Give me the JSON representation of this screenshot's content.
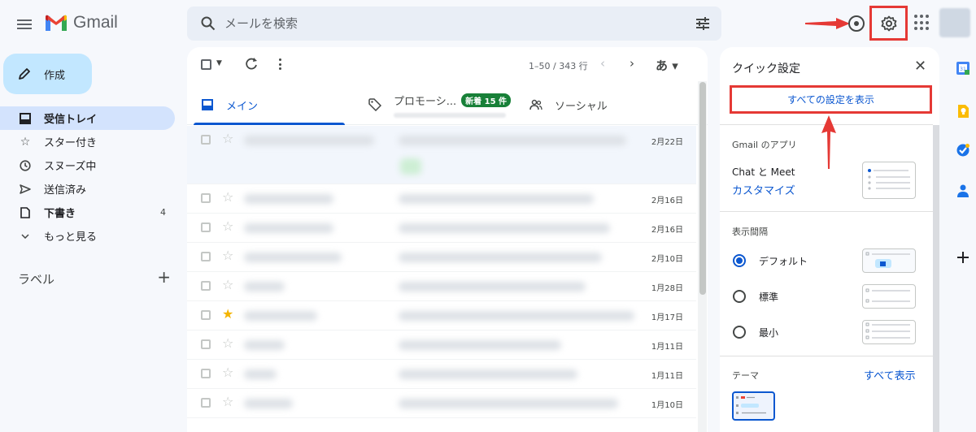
{
  "header": {
    "app_name": "Gmail",
    "search_placeholder": "メールを検索"
  },
  "sidebar": {
    "compose_label": "作成",
    "items": [
      {
        "label": "受信トレイ",
        "icon": "inbox-icon",
        "active": true,
        "count": ""
      },
      {
        "label": "スター付き",
        "icon": "star-icon",
        "count": ""
      },
      {
        "label": "スヌーズ中",
        "icon": "clock-icon",
        "count": ""
      },
      {
        "label": "送信済み",
        "icon": "send-icon",
        "count": ""
      },
      {
        "label": "下書き",
        "icon": "draft-icon",
        "count": "4"
      },
      {
        "label": "もっと見る",
        "icon": "chevron-down-icon",
        "count": ""
      }
    ],
    "labels_heading": "ラベル",
    "labels_add": "+"
  },
  "toolbar": {
    "range": "1–50 / 343 行",
    "language": "あ ▾"
  },
  "tabs": [
    {
      "label": "メイン",
      "icon": "inbox-tab-icon"
    },
    {
      "label": "プロモーシ...",
      "badge": "新着 15 件",
      "icon": "tag-icon"
    },
    {
      "label": "ソーシャル",
      "icon": "people-icon"
    }
  ],
  "mail_rows": [
    {
      "date": "2月22日",
      "starred": false
    },
    {
      "date": "2月16日",
      "starred": false
    },
    {
      "date": "2月16日",
      "starred": false
    },
    {
      "date": "2月10日",
      "starred": false
    },
    {
      "date": "1月28日",
      "starred": false
    },
    {
      "date": "1月17日",
      "starred": true
    },
    {
      "date": "1月11日",
      "starred": false
    },
    {
      "date": "1月11日",
      "starred": false
    },
    {
      "date": "1月10日",
      "starred": false
    }
  ],
  "quick_settings": {
    "title": "クイック設定",
    "close": "✕",
    "see_all_settings": "すべての設定を表示",
    "apps_heading": "Gmail のアプリ",
    "chat_meet": "Chat と Meet",
    "customize": "カスタマイズ",
    "density_heading": "表示間隔",
    "density_options": [
      {
        "label": "デフォルト",
        "selected": true
      },
      {
        "label": "標準",
        "selected": false
      },
      {
        "label": "最小",
        "selected": false
      }
    ],
    "theme_heading": "テーマ",
    "theme_see_all": "すべて表示"
  },
  "colors": {
    "accent": "#0b57d0",
    "highlight_red": "#e53935",
    "compose_bg": "#c2e7ff",
    "badge_green": "#188038"
  }
}
